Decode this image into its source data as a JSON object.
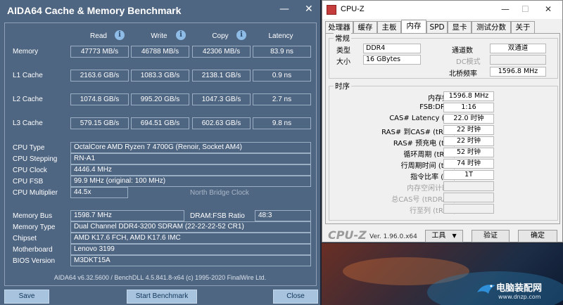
{
  "aida": {
    "title": "AIDA64 Cache & Memory Benchmark",
    "minimize": "—",
    "close": "✕",
    "headers": {
      "read": "Read",
      "write": "Write",
      "copy": "Copy",
      "latency": "Latency"
    },
    "rows": [
      {
        "label": "Memory",
        "read": "47773 MB/s",
        "write": "46788 MB/s",
        "copy": "42306 MB/s",
        "latency": "83.9 ns"
      },
      {
        "label": "L1 Cache",
        "read": "2163.6 GB/s",
        "write": "1083.3 GB/s",
        "copy": "2138.1 GB/s",
        "latency": "0.9 ns"
      },
      {
        "label": "L2 Cache",
        "read": "1074.8 GB/s",
        "write": "995.20 GB/s",
        "copy": "1047.3 GB/s",
        "latency": "2.7 ns"
      },
      {
        "label": "L3 Cache",
        "read": "579.15 GB/s",
        "write": "694.51 GB/s",
        "copy": "602.63 GB/s",
        "latency": "9.8 ns"
      }
    ],
    "cpu_type_label": "CPU Type",
    "cpu_type": "OctalCore AMD Ryzen 7 4700G  (Renoir, Socket AM4)",
    "cpu_stepping_label": "CPU Stepping",
    "cpu_stepping": "RN-A1",
    "cpu_clock_label": "CPU Clock",
    "cpu_clock": "4446.4 MHz",
    "cpu_fsb_label": "CPU FSB",
    "cpu_fsb": "99.9 MHz  (original: 100 MHz)",
    "cpu_mult_label": "CPU Multiplier",
    "cpu_mult": "44.5x",
    "nb_clock_label": "North Bridge Clock",
    "mem_bus_label": "Memory Bus",
    "mem_bus": "1598.7 MHz",
    "dram_fsb_label": "DRAM:FSB Ratio",
    "dram_fsb": "48:3",
    "mem_type_label": "Memory Type",
    "mem_type": "Dual Channel DDR4-3200 SDRAM  (22-22-22-52 CR1)",
    "chipset_label": "Chipset",
    "chipset": "AMD K17.6 FCH, AMD K17.6 IMC",
    "mobo_label": "Motherboard",
    "mobo": "Lenovo 3199",
    "bios_label": "BIOS Version",
    "bios": "M3DKT15A",
    "footer": "AIDA64 v6.32.5600 / BenchDLL 4.5.841.8-x64  (c) 1995-2020 FinalWire Ltd.",
    "save": "Save",
    "start": "Start Benchmark",
    "close_btn": "Close",
    "colors": {
      "bg": "#4f6682",
      "button": "#a7c3de"
    }
  },
  "cpuz": {
    "title": "CPU-Z",
    "minimize": "—",
    "maximize": "☐",
    "close": "✕",
    "tabs": [
      "处理器",
      "缓存",
      "主板",
      "内存",
      "SPD",
      "显卡",
      "测试分数",
      "关于"
    ],
    "active_tab": "内存",
    "general": {
      "title": "常规",
      "type_label": "类型",
      "type": "DDR4",
      "size_label": "大小",
      "size": "16 GBytes",
      "channels_label": "通道数",
      "channels": "双通道",
      "dc_label": "DC模式",
      "dc": "",
      "nb_label": "北桥频率",
      "nb": "1596.8 MHz"
    },
    "timings": {
      "title": "时序",
      "items": [
        {
          "label": "内存频率",
          "value": "1596.8 MHz",
          "dim": false
        },
        {
          "label": "FSB:DRAM",
          "value": "1:16",
          "dim": false
        },
        {
          "label": "CAS# Latency (CL)",
          "value": "22.0 时钟",
          "dim": false
        },
        {
          "label": "RAS# 到CAS# (tRCD)",
          "value": "22 时钟",
          "dim": false
        },
        {
          "label": "RAS# 预充电 (tRP)",
          "value": "22 时钟",
          "dim": false
        },
        {
          "label": "循环周期 (tRAS)",
          "value": "52 时钟",
          "dim": false
        },
        {
          "label": "行周期时间 (tRC)",
          "value": "74 时钟",
          "dim": false
        },
        {
          "label": "指令比率 (CR)",
          "value": "1T",
          "dim": false
        },
        {
          "label": "内存空闲计时器",
          "value": "",
          "dim": true
        },
        {
          "label": "总CAS号 (tRDRAM)",
          "value": "",
          "dim": true
        },
        {
          "label": "行至列 (tRCD)",
          "value": "",
          "dim": true
        }
      ]
    },
    "brand": "CPU-Z",
    "version": "Ver. 1.96.0.x64",
    "tools": "工具",
    "validate": "验证",
    "ok": "确定"
  },
  "watermark": {
    "text": "电脑装配网",
    "url": "www.dnzp.com"
  }
}
